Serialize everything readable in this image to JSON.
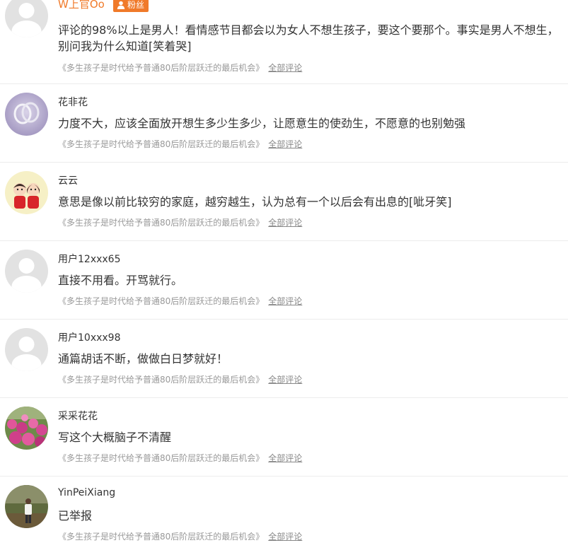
{
  "badge": {
    "fan_label": "粉丝"
  },
  "comments": [
    {
      "user": "W上官Oo",
      "text": "评论的98%以上是男人！看情感节目都会以为女人不想生孩子，要这个要那个。事实是男人不想生，别问我为什么知道[笑着哭]",
      "article": "《多生孩子是时代给予普通80后阶层跃迁的最后机会》",
      "all_link": "全部评论",
      "avatar": "default-avatar-icon"
    },
    {
      "user": "花非花",
      "text": "力度不大，应该全面放开想生多少生多少，让愿意生的使劲生，不愿意的也别勉强",
      "article": "《多生孩子是时代给予普通80后阶层跃迁的最后机会》",
      "all_link": "全部评论",
      "avatar": "rings-photo-avatar"
    },
    {
      "user": "云云",
      "text": "意思是像以前比较穷的家庭，越穷越生，认为总有一个以后会有出息的[呲牙笑]",
      "article": "《多生孩子是时代给予普通80后阶层跃迁的最后机会》",
      "all_link": "全部评论",
      "avatar": "cartoon-couple-avatar"
    },
    {
      "user": "用户12xxx65",
      "text": "直接不用看。开骂就行。",
      "article": "《多生孩子是时代给予普通80后阶层跃迁的最后机会》",
      "all_link": "全部评论",
      "avatar": "default-avatar-icon"
    },
    {
      "user": "用户10xxx98",
      "text": "通篇胡话不断，做做白日梦就好！",
      "article": "《多生孩子是时代给予普通80后阶层跃迁的最后机会》",
      "all_link": "全部评论",
      "avatar": "default-avatar-icon"
    },
    {
      "user": "采采花花",
      "text": "写这个大概脑子不清醒",
      "article": "《多生孩子是时代给予普通80后阶层跃迁的最后机会》",
      "all_link": "全部评论",
      "avatar": "flowers-photo-avatar"
    },
    {
      "user": "YinPeiXiang",
      "text": "已举报",
      "article": "《多生孩子是时代给予普通80后阶层跃迁的最后机会》",
      "all_link": "全部评论",
      "avatar": "person-photo-avatar"
    }
  ],
  "colors": {
    "accent": "#f07a2a",
    "text": "#333333",
    "meta": "#999999"
  }
}
